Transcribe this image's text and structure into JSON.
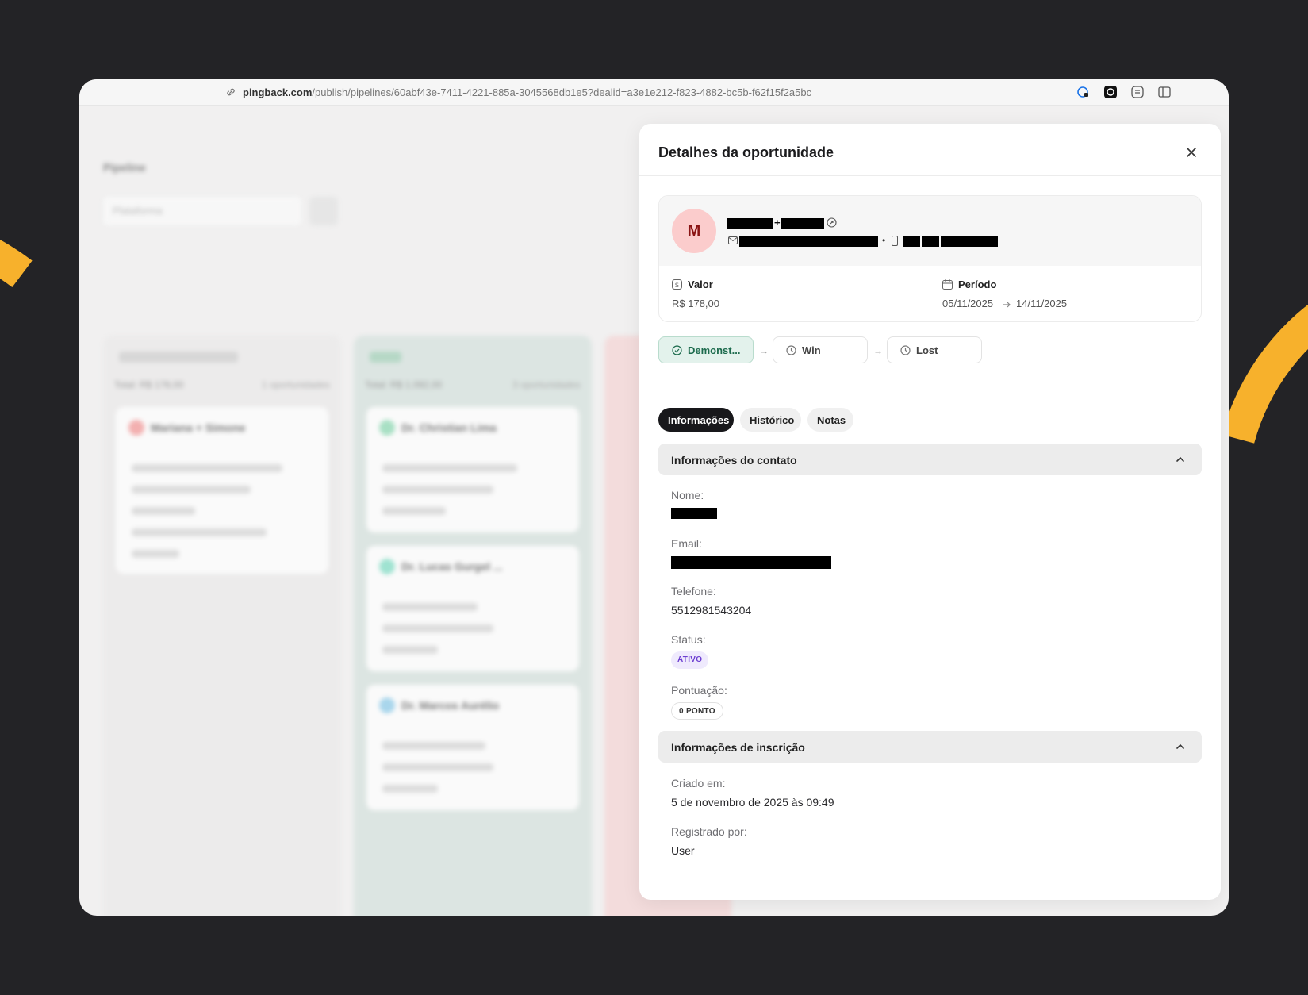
{
  "browser": {
    "url_domain": "pingback.com",
    "url_path": "/publish/pipelines/60abf43e-7411-4221-885a-3045568db1e5?dealid=a3e1e212-f823-4882-bc5b-f62f15f2a5bc",
    "extension_icons": [
      "shield-lock-icon",
      "brand-icon",
      "menu-icon",
      "sidebar-icon"
    ]
  },
  "background": {
    "title": "Pipeline",
    "search_placeholder": "Plataforma",
    "columns": [
      {
        "header": "DEMONSTRAÇÃO REALIZADA",
        "total": "Total: R$ 178,00",
        "count": "1 oportunidades",
        "cards": [
          {
            "name": "Mariana + Simone",
            "lines": [
              "paivamarianasaate@gmail.com",
              "+55 (12) 98154-3204",
              "R$ 178,00",
              "05/11/2025 → 14/11/2025",
              "9 dias"
            ]
          }
        ]
      },
      {
        "header": "WIN",
        "total": "Total: R$ 1.092,00",
        "count": "3 oportunidades",
        "cards": [
          {
            "name": "Dr. Christian Lima",
            "lines": [
              "christianlima85@gmail.com",
              "+55 (68) 98202-5043",
              "R$ 894,00"
            ]
          },
          {
            "name": "Dr. Lucas Gurgel ...",
            "lines": [
              "lucasgfra@gmail.com",
              "+55 (15) 99575-3883",
              "R$ 99,00"
            ]
          },
          {
            "name": "Dr. Marcos Aurélio",
            "lines": [
              "maaaelam@gmail.com",
              "+55 (31) 98886-9738",
              "R$ 99,00"
            ]
          }
        ]
      }
    ]
  },
  "panel": {
    "title": "Detalhes da oportunidade",
    "close_icon": "close-icon",
    "contact": {
      "avatar_initial": "M",
      "valor_label": "Valor",
      "valor_value": "R$ 178,00",
      "periodo_label": "Período",
      "periodo_start": "05/11/2025",
      "periodo_end": "14/11/2025"
    },
    "stages": [
      {
        "label": "Demonst...",
        "active": true
      },
      {
        "label": "Win",
        "active": false
      },
      {
        "label": "Lost",
        "active": false
      }
    ],
    "tabs": [
      {
        "label": "Informações",
        "active": true
      },
      {
        "label": "Histórico",
        "active": false
      },
      {
        "label": "Notas",
        "active": false
      }
    ],
    "section_contact": {
      "title": "Informações do contato",
      "nome_label": "Nome:",
      "email_label": "Email:",
      "telefone_label": "Telefone:",
      "telefone_value": "5512981543204",
      "status_label": "Status:",
      "status_value": "ATIVO",
      "pontuacao_label": "Pontuação:",
      "pontuacao_value": "0 PONTO"
    },
    "section_inscricao": {
      "title": "Informações de inscrição",
      "criado_label": "Criado em:",
      "criado_value": "5 de novembro de 2025 às 09:49",
      "registrado_label": "Registrado por:",
      "registrado_value": "User"
    }
  },
  "colors": {
    "backdrop": "#232326",
    "accent_swoosh": "#f7b12c",
    "stage_active_bg": "#e3f2ec",
    "stage_active_text": "#1c6b4d",
    "status_badge_text": "#6d3fd1",
    "avatar_bg": "#fbcccc"
  }
}
